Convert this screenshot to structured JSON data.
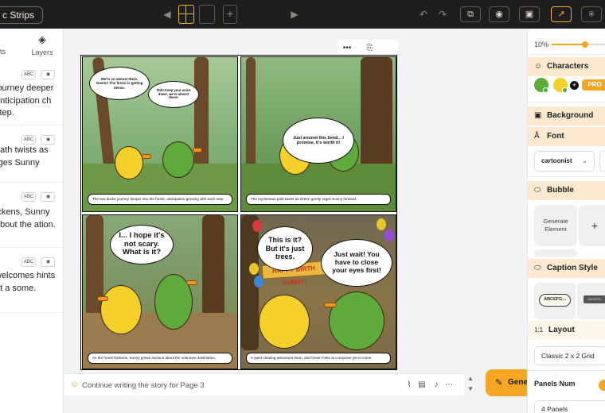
{
  "topbar": {
    "app_title": "c Strips",
    "prev_label": "◀",
    "next_label": "▶",
    "add_page_label": "+",
    "undo_label": "↶",
    "redo_label": "↷",
    "buttons": [
      "⧉",
      "◉",
      "▣",
      "↗",
      "⍟"
    ]
  },
  "left_panel": {
    "tabs": [
      {
        "label": "pts",
        "icon": "scripts-icon"
      },
      {
        "label": "Layers",
        "icon": "layers-icon"
      }
    ],
    "spellcheck_label": "ABC",
    "preview_label": "◉",
    "scripts": [
      {
        "text": "journey deeper anticipation ch step."
      },
      {
        "text": "path twists as rges Sunny"
      },
      {
        "text": "ickens, Sunny about the ation."
      },
      {
        "text": "welcomes hints at a some."
      }
    ]
  },
  "canvas_toolbar": {
    "more": "•••",
    "duplicate": "⎘",
    "download": "⤓"
  },
  "comic": {
    "panels": [
      {
        "speech": [
          "We're so almost there, Green!! The forest is getting dense.",
          "Shh! Keep your voice down, we're almost there!"
        ],
        "caption": "The two ducks journey deeper into the forest, anticipation growing with each step."
      },
      {
        "speech": [
          "Just around this bend... I promise, it's worth it!"
        ],
        "caption": "The mysterious path twists as Green gently urges Sunny forward."
      },
      {
        "speech": [
          "I... I hope it's not scary. What is it?"
        ],
        "caption": "As the forest thickens, Sunny grows anxious about the unknown destination."
      },
      {
        "speech": [
          "This is it? But it's just trees.",
          "Just wait! You have to close your eyes first!"
        ],
        "banner": "HAPPY BIRTH SUNNY!",
        "caption": "A quiet clearing welcomes them, and Green hints at a surprise yet to come."
      }
    ]
  },
  "prompt": {
    "placeholder": "Continue writing the story for Page 3"
  },
  "generate": {
    "label": "Gene"
  },
  "right_panel": {
    "zoom": {
      "label": "10%",
      "level": 0.6
    },
    "sections": {
      "characters": "Characters",
      "background": "Background",
      "font": "Font",
      "bubble": "Bubble",
      "caption_style": "Caption Style",
      "layout": "Layout",
      "panels_num": "Panels Num"
    },
    "pro_label": "PRO",
    "character_add": "+",
    "font_value": "cartoonist",
    "font_chevron": "⌄",
    "bubble_tile": "Generate Element",
    "bubble_add": "+",
    "caption_sample_1": "ABCEFG...",
    "caption_sample_2": "ABCEFG...",
    "layout_icon_text": "1:1",
    "layout_value": "Classic 2 x 2 Grid",
    "panels_value": "4 Panels"
  },
  "colors": {
    "accent": "#f5a623",
    "topbar": "#201e1d",
    "section_head": "#fde9cf"
  }
}
